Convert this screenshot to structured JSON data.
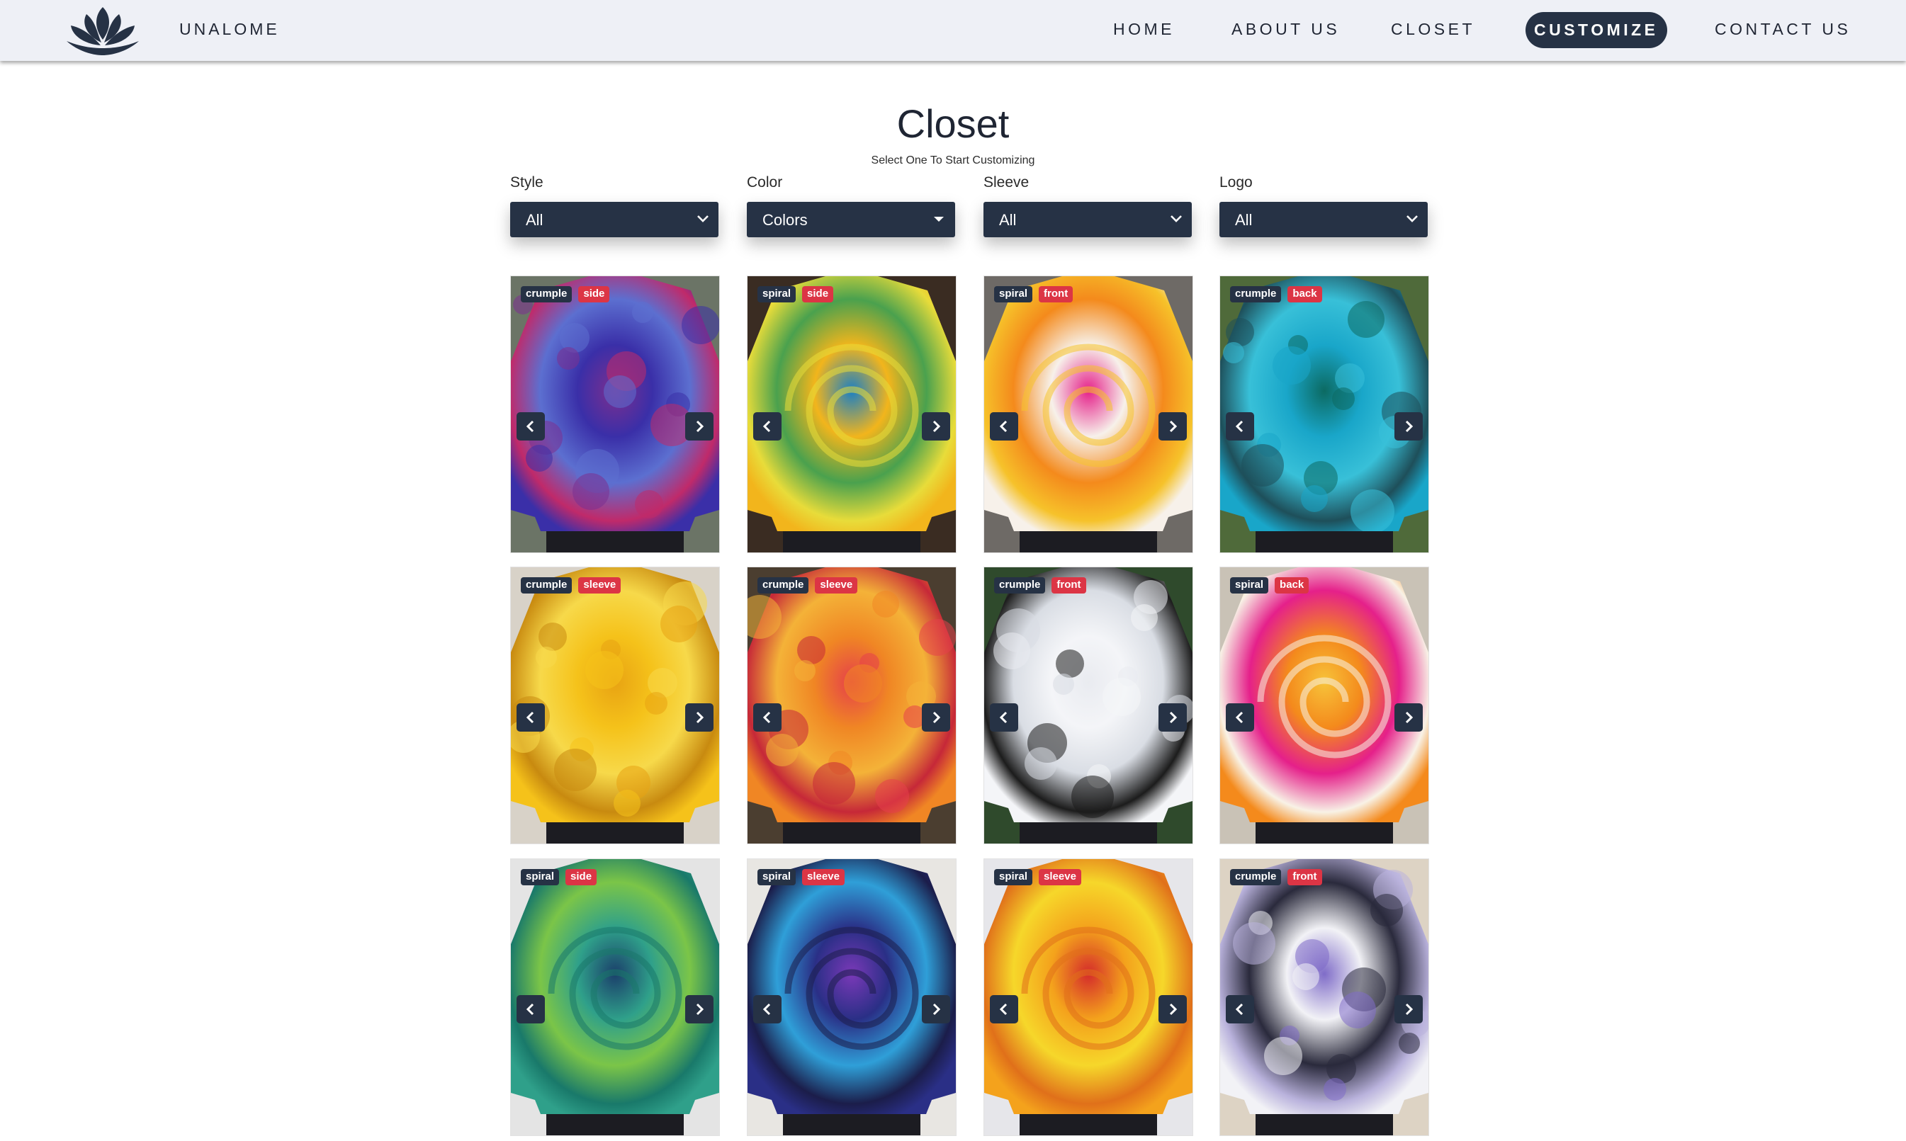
{
  "brand": {
    "name": "UNALOME",
    "logo_icon": "lotus-icon"
  },
  "nav": [
    {
      "label": "HOME",
      "active": false
    },
    {
      "label": "ABOUT US",
      "active": false
    },
    {
      "label": "CLOSET",
      "active": false
    },
    {
      "label": "CUSTOMIZE",
      "active": true
    },
    {
      "label": "CONTACT US",
      "active": false
    }
  ],
  "page": {
    "title": "Closet",
    "subtitle": "Select One To Start Customizing"
  },
  "filters": [
    {
      "label": "Style",
      "value": "All"
    },
    {
      "label": "Color",
      "value": "Colors"
    },
    {
      "label": "Sleeve",
      "value": "All"
    },
    {
      "label": "Logo",
      "value": "All"
    }
  ],
  "products": [
    {
      "style": "crumple",
      "logo": "side",
      "colors": [
        "#3a2fa8",
        "#7c2f8f",
        "#5c6fd0",
        "#c02a6a"
      ]
    },
    {
      "style": "spiral",
      "logo": "side",
      "colors": [
        "#f2b51c",
        "#1a7fc4",
        "#4aa14e",
        "#e8dc3a"
      ]
    },
    {
      "style": "spiral",
      "logo": "front",
      "colors": [
        "#f7f1ea",
        "#e5208a",
        "#f48a1c",
        "#f6c22a"
      ]
    },
    {
      "style": "crumple",
      "logo": "back",
      "colors": [
        "#19a6c9",
        "#0c6a62",
        "#38c0d8",
        "#1e4f5a"
      ]
    },
    {
      "style": "crumple",
      "logo": "sleeve",
      "colors": [
        "#f5c21a",
        "#e8a313",
        "#f7d94a",
        "#c88a10"
      ]
    },
    {
      "style": "crumple",
      "logo": "sleeve",
      "colors": [
        "#f08624",
        "#e5404a",
        "#f4b238",
        "#c62838"
      ]
    },
    {
      "style": "crumple",
      "logo": "front",
      "colors": [
        "#f4f5f8",
        "#e9ebf0",
        "#d9dde4",
        "#1c1c1c"
      ]
    },
    {
      "style": "spiral",
      "logo": "back",
      "colors": [
        "#f48a1c",
        "#f7c33a",
        "#e5208a",
        "#f8f2e6"
      ]
    },
    {
      "style": "spiral",
      "logo": "side",
      "colors": [
        "#2fa08a",
        "#1b3f6b",
        "#7bc548",
        "#19796a"
      ]
    },
    {
      "style": "spiral",
      "logo": "sleeve",
      "colors": [
        "#2a2f86",
        "#7a39b8",
        "#2f9fd8",
        "#1b1d4a"
      ]
    },
    {
      "style": "spiral",
      "logo": "sleeve",
      "colors": [
        "#f4a21c",
        "#d42b2b",
        "#f6d72a",
        "#e0701a"
      ]
    },
    {
      "style": "crumple",
      "logo": "front",
      "colors": [
        "#f2f2f6",
        "#7f6cc8",
        "#2a2a3c",
        "#b9b2dc"
      ]
    }
  ],
  "icons": {
    "prev": "chevron-left-icon",
    "next": "chevron-right-icon",
    "select": "chevron-down-icon"
  }
}
